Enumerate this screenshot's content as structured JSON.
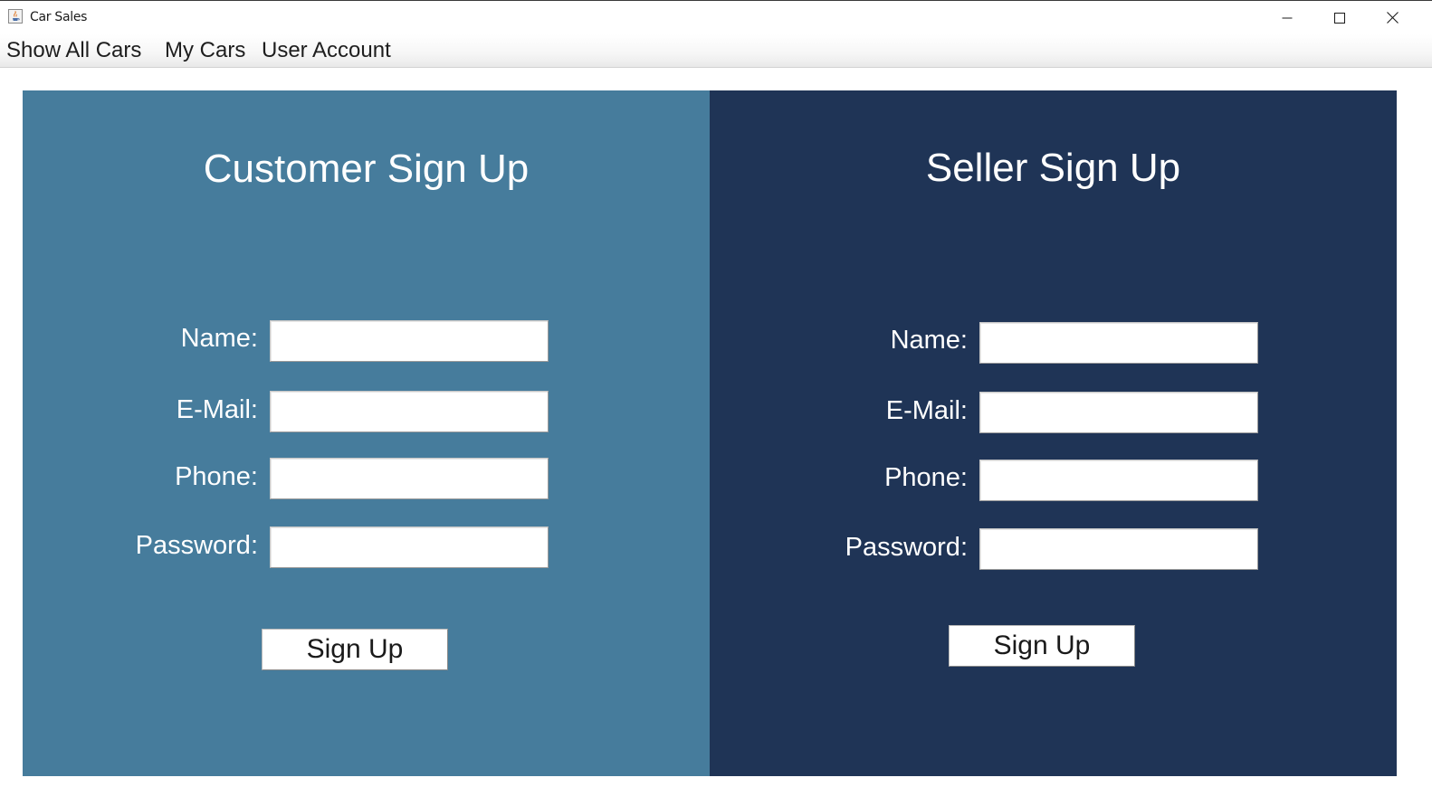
{
  "window": {
    "title": "Car Sales",
    "icon": "java-cup-icon",
    "controls": [
      "minimize-icon",
      "maximize-icon",
      "close-icon"
    ]
  },
  "menu": {
    "items": [
      {
        "label": "Show All Cars"
      },
      {
        "label": "My Cars"
      },
      {
        "label": "User Account"
      }
    ]
  },
  "colors": {
    "customer_panel": "#467c9c",
    "seller_panel": "#1f3456",
    "panel_text": "#ffffff"
  },
  "customer": {
    "title": "Customer Sign Up",
    "fields": [
      {
        "label": "Name:",
        "value": ""
      },
      {
        "label": "E-Mail:",
        "value": ""
      },
      {
        "label": "Phone:",
        "value": ""
      },
      {
        "label": "Password:",
        "value": ""
      }
    ],
    "button_label": "Sign Up"
  },
  "seller": {
    "title": "Seller Sign Up",
    "fields": [
      {
        "label": "Name:",
        "value": ""
      },
      {
        "label": "E-Mail:",
        "value": ""
      },
      {
        "label": "Phone:",
        "value": ""
      },
      {
        "label": "Password:",
        "value": ""
      }
    ],
    "button_label": "Sign Up"
  }
}
